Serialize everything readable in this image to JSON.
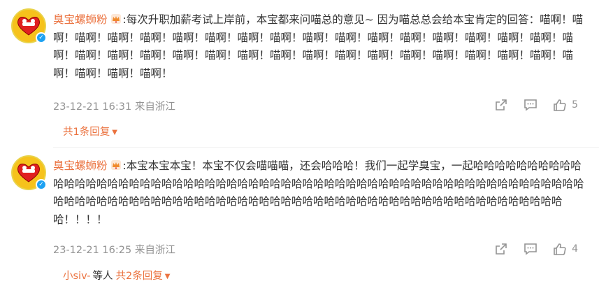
{
  "comments": [
    {
      "username": "臭宝螺蛳粉",
      "text": ":每次升职加薪考试上岸前，本宝都来问喵总的意见~ 因为喵总总会给本宝肯定的回答：喵啊！喵啊！喵啊！喵啊！喵啊！喵啊！喵啊！喵啊！喵啊！喵啊！喵啊！喵啊！喵啊！喵啊！喵啊！喵啊！喵啊！喵啊！喵啊！喵啊！喵啊！喵啊！喵啊！喵啊！喵啊！喵啊！喵啊！喵啊！喵啊！喵啊！喵啊！喵啊！喵啊！喵啊！喵啊！喵啊！喵啊！",
      "time": "23-12-21 16:31 来自浙江",
      "likes": "5",
      "replies_label": "共1条回复"
    },
    {
      "username": "臭宝螺蛳粉",
      "text": ":本宝本宝本宝！本宝不仅会喵喵喵，还会哈哈哈！我们一起学臭宝，一起哈哈哈哈哈哈哈哈哈哈哈哈哈哈哈哈哈哈哈哈哈哈哈哈哈哈哈哈哈哈哈哈哈哈哈哈哈哈哈哈哈哈哈哈哈哈哈哈哈哈哈哈哈哈哈哈哈哈哈哈哈哈哈哈哈哈哈哈哈哈哈哈哈哈哈哈哈哈哈哈哈哈哈哈哈哈哈哈哈哈哈哈哈哈哈哈哈哈哈哈哈哈哈哈哈哈哈！！！！",
      "time": "23-12-21 16:25 来自浙江",
      "likes": "4",
      "reply_user": "小siv-",
      "reply_mid": "等人",
      "replies_label": "共2条回复"
    }
  ],
  "colors": {
    "accent": "#eb7340",
    "meta": "#939393",
    "text": "#333333",
    "verified": "#1da1f2",
    "avatar_bg": "#f6c21c"
  },
  "icons": [
    "share-icon",
    "comment-icon",
    "like-icon",
    "crown-icon",
    "verified-badge-icon",
    "chevron-down-icon"
  ]
}
